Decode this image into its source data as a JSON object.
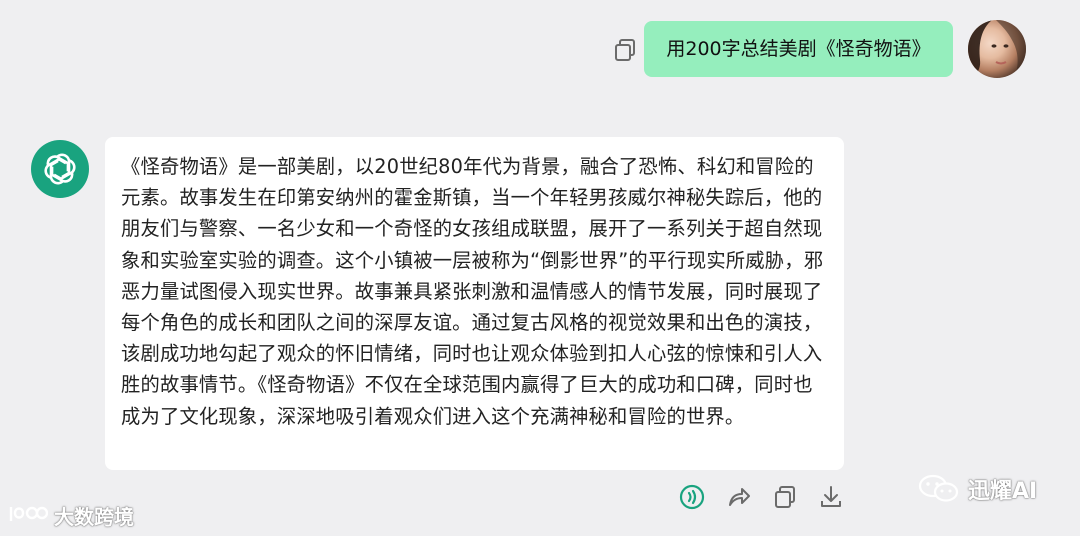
{
  "conversation": {
    "user_message": "用200字总结美剧《怪奇物语》",
    "bot_message": "《怪奇物语》是一部美剧，以20世纪80年代为背景，融合了恐怖、科幻和冒险的元素。故事发生在印第安纳州的霍金斯镇，当一个年轻男孩威尔神秘失踪后，他的朋友们与警察、一名少女和一个奇怪的女孩组成联盟，展开了一系列关于超自然现象和实验室实验的调查。这个小镇被一层被称为“倒影世界”的平行现实所威胁，邪恶力量试图侵入现实世界。故事兼具紧张刺激和温情感人的情节发展，同时展现了每个角色的成长和团队之间的深厚友谊。通过复古风格的视觉效果和出色的演技，该剧成功地勾起了观众的怀旧情绪，同时也让观众体验到扣人心弦的惊悚和引人入胜的故事情节。《怪奇物语》不仅在全球范围内赢得了巨大的成功和口碑，同时也成为了文化现象，深深地吸引着观众们进入这个充满神秘和冒险的世界。"
  },
  "colors": {
    "background": "#efeff1",
    "user_bubble": "#95eebd",
    "bot_avatar": "#19a37f",
    "speaker_icon": "#19a37f",
    "icon_gray": "#6b6b6b"
  },
  "icons": {
    "user_copy": "copy-icon",
    "bot_logo": "openai-logo-icon",
    "actions": [
      "speaker-icon",
      "share-icon",
      "copy-icon",
      "download-icon"
    ]
  },
  "watermarks": {
    "left": "大数跨境",
    "right": "迅耀AI"
  }
}
